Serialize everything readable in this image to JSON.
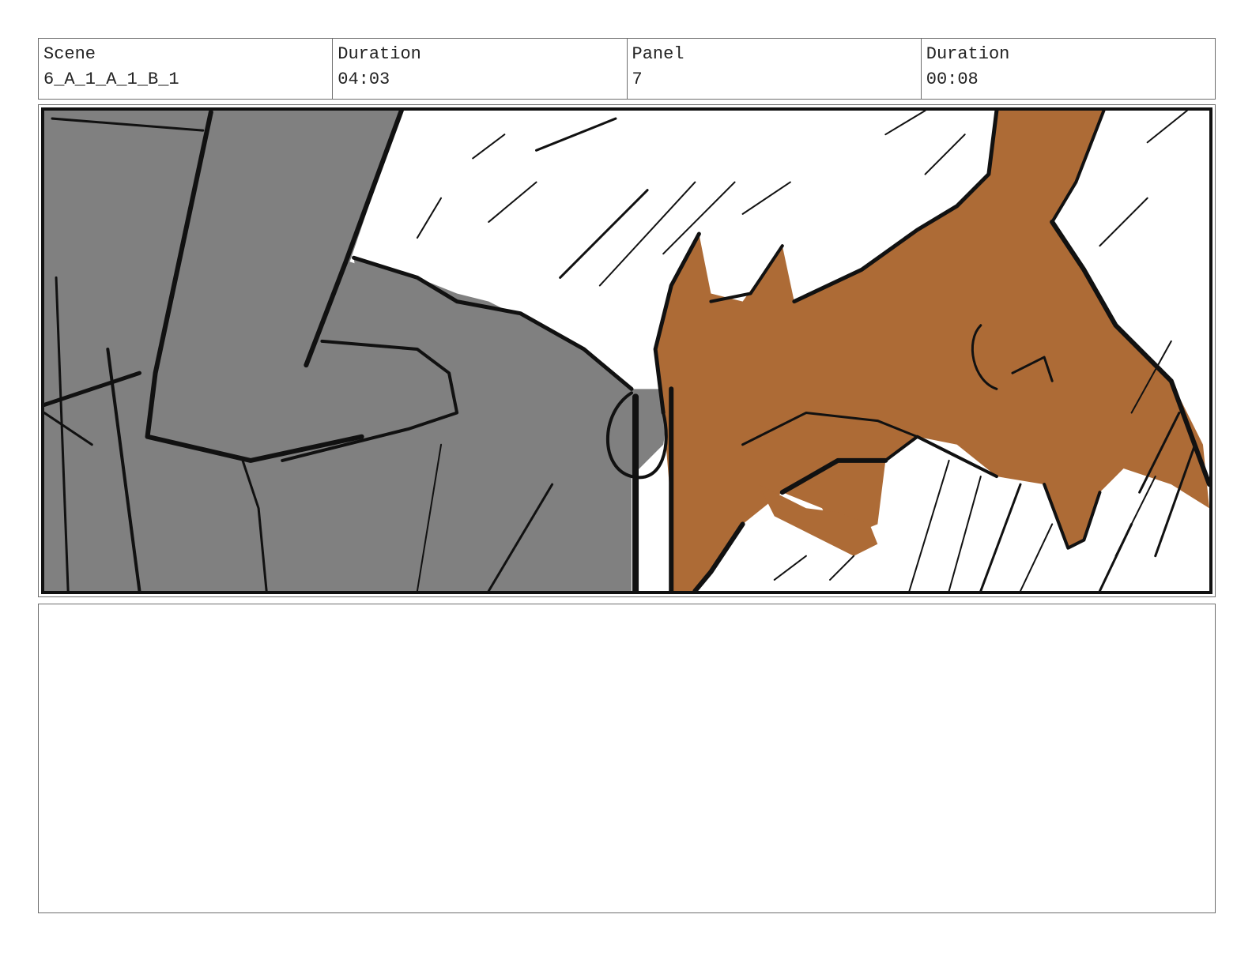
{
  "header": {
    "scene_label": "Scene",
    "scene_value": "6_A_1_A_1_B_1",
    "scene_duration_label": "Duration",
    "scene_duration_value": "04:03",
    "panel_label": "Panel",
    "panel_value": "7",
    "panel_duration_label": "Duration",
    "panel_duration_value": "00:08"
  },
  "panel": {
    "colors": {
      "sleeve_gray": "#808080",
      "fur_brown": "#ad6b36",
      "ink": "#111111",
      "paper": "#ffffff"
    }
  },
  "notes": {
    "text": ""
  }
}
